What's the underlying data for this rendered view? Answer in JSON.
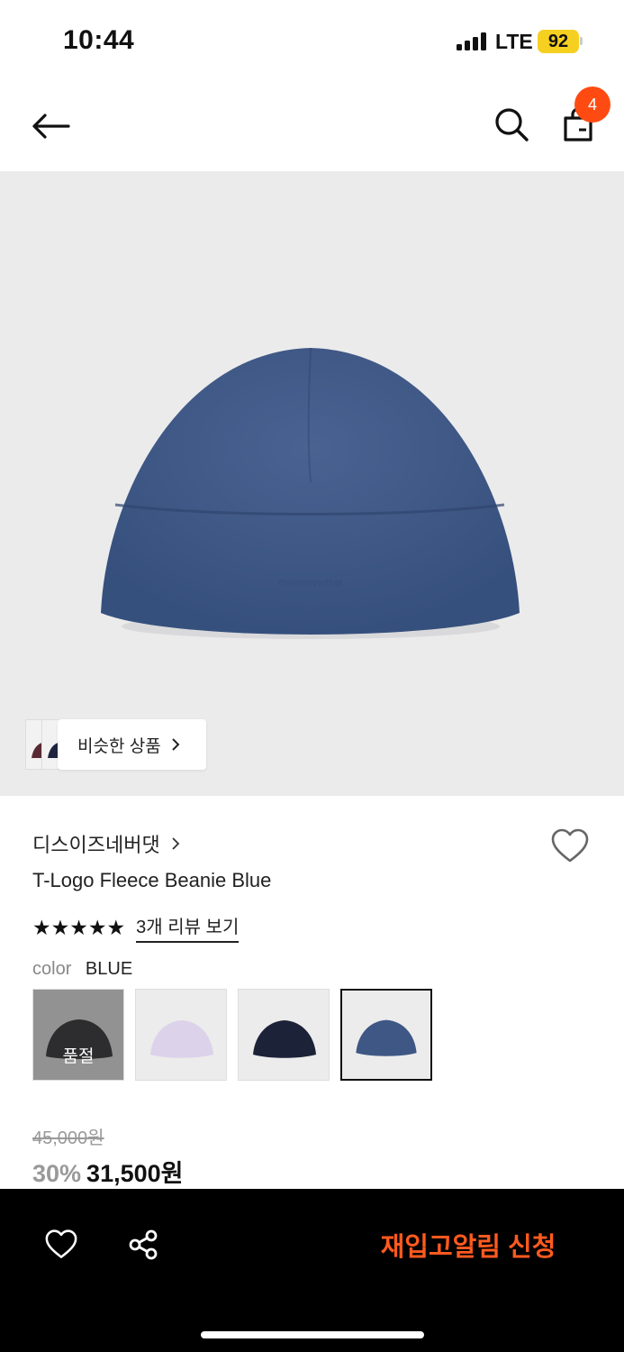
{
  "status_bar": {
    "time": "10:44",
    "network": "LTE",
    "battery": "92"
  },
  "header": {
    "cart_count": "4"
  },
  "similar": {
    "label": "비슷한 상품"
  },
  "product": {
    "brand": "디스이즈네버댓",
    "name": "T-Logo Fleece Beanie Blue",
    "rating_stars": "★★★★★",
    "review_link": "3개 리뷰 보기",
    "option_label": "color",
    "option_value": "BLUE",
    "swatches": [
      {
        "color": "grey",
        "sold_out_label": "품절"
      },
      {
        "color": "lavender"
      },
      {
        "color": "navy"
      },
      {
        "color": "blue",
        "selected": true
      }
    ],
    "original_price": "45,000원",
    "discount": "30%",
    "final_price": "31,500원"
  },
  "bottom_bar": {
    "restock_label": "재입고알림 신청"
  },
  "colors": {
    "accent": "#ff5a1f",
    "badge": "#ff4b12",
    "product": "#3e5785"
  }
}
